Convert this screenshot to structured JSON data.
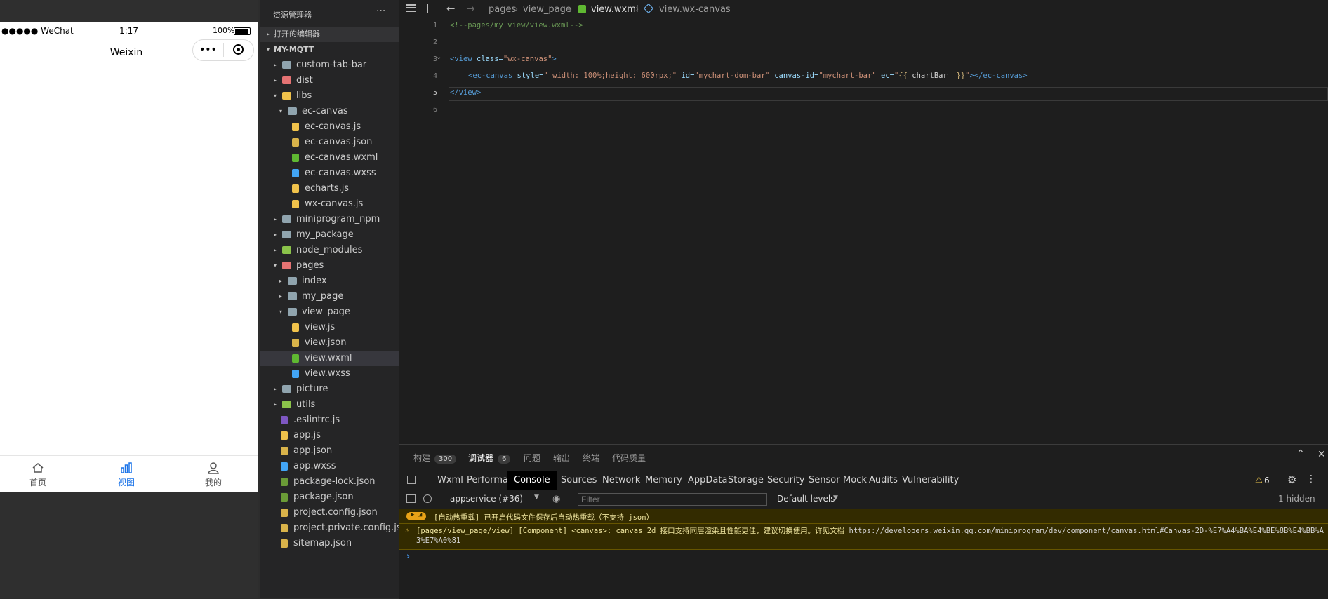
{
  "simulator": {
    "status_left": "●●●●● WeChat",
    "status_time": "1:17",
    "status_battery": "100%",
    "nav_title": "Weixin",
    "tabs": [
      {
        "label": "首页",
        "icon": "home-icon"
      },
      {
        "label": "视图",
        "icon": "bar-chart-icon",
        "active": true
      },
      {
        "label": "我的",
        "icon": "user-icon"
      }
    ]
  },
  "explorer": {
    "title": "资源管理器",
    "more": "···",
    "open_editors": "打开的编辑器",
    "project": "MY-MQTT",
    "tree": [
      {
        "label": "custom-tab-bar",
        "indent": 1,
        "type": "folder",
        "arrow": "▸"
      },
      {
        "label": "dist",
        "indent": 1,
        "type": "folder-red",
        "arrow": "▸"
      },
      {
        "label": "libs",
        "indent": 1,
        "type": "folder-yellow",
        "arrow": "▾"
      },
      {
        "label": "ec-canvas",
        "indent": 2,
        "type": "folder-open",
        "arrow": "▾"
      },
      {
        "label": "ec-canvas.js",
        "indent": 3,
        "type": "js"
      },
      {
        "label": "ec-canvas.json",
        "indent": 3,
        "type": "json"
      },
      {
        "label": "ec-canvas.wxml",
        "indent": 3,
        "type": "wxml"
      },
      {
        "label": "ec-canvas.wxss",
        "indent": 3,
        "type": "wxss"
      },
      {
        "label": "echarts.js",
        "indent": 3,
        "type": "js"
      },
      {
        "label": "wx-canvas.js",
        "indent": 3,
        "type": "js"
      },
      {
        "label": "miniprogram_npm",
        "indent": 1,
        "type": "folder",
        "arrow": "▸"
      },
      {
        "label": "my_package",
        "indent": 1,
        "type": "folder",
        "arrow": "▸"
      },
      {
        "label": "node_modules",
        "indent": 1,
        "type": "folder-green",
        "arrow": "▸"
      },
      {
        "label": "pages",
        "indent": 1,
        "type": "folder-red",
        "arrow": "▾"
      },
      {
        "label": "index",
        "indent": 2,
        "type": "folder",
        "arrow": "▸"
      },
      {
        "label": "my_page",
        "indent": 2,
        "type": "folder",
        "arrow": "▸"
      },
      {
        "label": "view_page",
        "indent": 2,
        "type": "folder-open",
        "arrow": "▾"
      },
      {
        "label": "view.js",
        "indent": 3,
        "type": "js"
      },
      {
        "label": "view.json",
        "indent": 3,
        "type": "json"
      },
      {
        "label": "view.wxml",
        "indent": 3,
        "type": "wxml",
        "selected": true
      },
      {
        "label": "view.wxss",
        "indent": 3,
        "type": "wxss"
      },
      {
        "label": "picture",
        "indent": 1,
        "type": "folder",
        "arrow": "▸"
      },
      {
        "label": "utils",
        "indent": 1,
        "type": "folder-green",
        "arrow": "▸"
      },
      {
        "label": ".eslintrc.js",
        "indent": 1,
        "type": "eslint"
      },
      {
        "label": "app.js",
        "indent": 1,
        "type": "js"
      },
      {
        "label": "app.json",
        "indent": 1,
        "type": "json"
      },
      {
        "label": "app.wxss",
        "indent": 1,
        "type": "wxss"
      },
      {
        "label": "package-lock.json",
        "indent": 1,
        "type": "npm"
      },
      {
        "label": "package.json",
        "indent": 1,
        "type": "npm"
      },
      {
        "label": "project.config.json",
        "indent": 1,
        "type": "json"
      },
      {
        "label": "project.private.config.js...",
        "indent": 1,
        "type": "json"
      },
      {
        "label": "sitemap.json",
        "indent": 1,
        "type": "json"
      }
    ]
  },
  "editor": {
    "breadcrumbs": [
      "pages",
      "view_page",
      "view.wxml",
      "view.wx-canvas"
    ],
    "line_numbers": [
      "1",
      "2",
      "3",
      "4",
      "5",
      "6"
    ],
    "line1": "<!--pages/my_view/view.wxml-->",
    "line3": {
      "open": "<view",
      "attr": " class=",
      "val": "\"wx-canvas\"",
      "close": ">"
    },
    "line4": {
      "open": "<ec-canvas",
      "a1": " style=",
      "v1": "\" width: 100%;height: 600rpx;\"",
      "a2": " id=",
      "v2": "\"mychart-dom-bar\"",
      "a3": " canvas-id=",
      "v3": "\"mychart-bar\"",
      "a4": " ec=",
      "v4a": "\"",
      "v4b": "{{",
      "v4c": " chartBar  ",
      "v4d": "}}",
      "v4e": "\"",
      "close": "></ec-canvas>"
    },
    "line5": "</view>"
  },
  "panel": {
    "tabs": [
      {
        "label": "构建",
        "badge": "300"
      },
      {
        "label": "调试器",
        "badge": "6",
        "active": true
      },
      {
        "label": "问题"
      },
      {
        "label": "输出"
      },
      {
        "label": "终端"
      },
      {
        "label": "代码质量"
      }
    ],
    "devtools_tabs": [
      "Wxml",
      "Performance",
      "Console",
      "Sources",
      "Network",
      "Memory",
      "AppData",
      "Storage",
      "Security",
      "Sensor",
      "Mock",
      "Audits",
      "Vulnerability"
    ],
    "active_devtool": "Console",
    "warning_count": "6",
    "context": "appservice (#36)",
    "filter_placeholder": "Filter",
    "levels": "Default levels",
    "hidden": "1 hidden",
    "msg1": "[自动热重载] 已开启代码文件保存后自动热重载（不支持 json）",
    "msg2_text": "[pages/view_page/view] [Component] <canvas>: canvas 2d 接口支持同层渲染且性能更佳，建议切换使用。详见文档 ",
    "msg2_link": "https://developers.weixin.qq.com/miniprogram/dev/component/canvas.html#Canvas-2D-%E7%A4%BA%E4%BE%8B%E4%BB%A3%E7%A0%81",
    "prompt": "›"
  }
}
